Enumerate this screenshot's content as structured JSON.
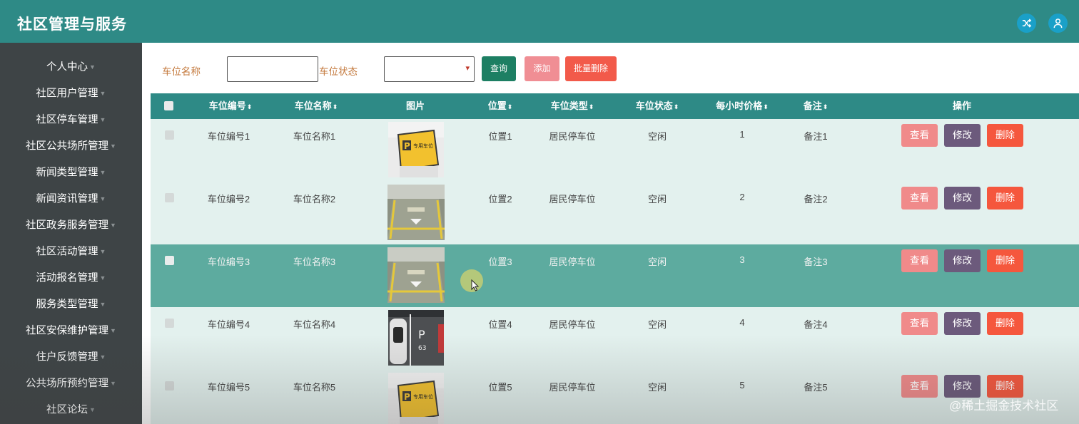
{
  "header": {
    "title": "社区管理与服务",
    "icons": [
      "shuffle-icon",
      "user-icon"
    ]
  },
  "sidebar": {
    "items": [
      {
        "label": "个人中心"
      },
      {
        "label": "社区用户管理"
      },
      {
        "label": "社区停车管理"
      },
      {
        "label": "社区公共场所管理"
      },
      {
        "label": "新闻类型管理"
      },
      {
        "label": "新闻资讯管理"
      },
      {
        "label": "社区政务服务管理"
      },
      {
        "label": "社区活动管理"
      },
      {
        "label": "活动报名管理"
      },
      {
        "label": "服务类型管理"
      },
      {
        "label": "社区安保维护管理"
      },
      {
        "label": "住户反馈管理"
      },
      {
        "label": "公共场所预约管理"
      },
      {
        "label": "社区论坛"
      }
    ]
  },
  "filter": {
    "name_label": "车位名称",
    "name_value": "",
    "status_label": "车位状态",
    "status_value": "",
    "query_label": "查询",
    "add_label": "添加",
    "batch_delete_label": "批量删除"
  },
  "table": {
    "columns": [
      "车位编号",
      "车位名称",
      "图片",
      "位置",
      "车位类型",
      "车位状态",
      "每小时价格",
      "备注",
      "操作"
    ],
    "rows": [
      {
        "code": "车位编号1",
        "name": "车位名称1",
        "image": "reserved-parking-sign",
        "location": "位置1",
        "type": "居民停车位",
        "status": "空闲",
        "price": "1",
        "note": "备注1"
      },
      {
        "code": "车位编号2",
        "name": "车位名称2",
        "image": "parking-lot-floor",
        "location": "位置2",
        "type": "居民停车位",
        "status": "空闲",
        "price": "2",
        "note": "备注2"
      },
      {
        "code": "车位编号3",
        "name": "车位名称3",
        "image": "parking-lot-floor",
        "location": "位置3",
        "type": "居民停车位",
        "status": "空闲",
        "price": "3",
        "note": "备注3"
      },
      {
        "code": "车位编号4",
        "name": "车位名称4",
        "image": "parking-spot-p63",
        "location": "位置4",
        "type": "居民停车位",
        "status": "空闲",
        "price": "4",
        "note": "备注4"
      },
      {
        "code": "车位编号5",
        "name": "车位名称5",
        "image": "reserved-parking-sign",
        "location": "位置5",
        "type": "居民停车位",
        "status": "空闲",
        "price": "5",
        "note": "备注5"
      }
    ],
    "actions": {
      "view": "查看",
      "edit": "修改",
      "delete": "删除"
    },
    "sign_text": "专用车位",
    "spot_text_p": "P",
    "spot_text_num": "63"
  },
  "watermark": "@稀土掘金技术社区",
  "colors": {
    "header_bg": "#2e8a86",
    "sidebar_bg": "#3e4446",
    "query_btn": "#1d7f63",
    "add_btn": "#f08e94",
    "batch_delete_btn": "#f25a4a",
    "view_btn": "#f08a8a",
    "edit_btn": "#6c5a7c",
    "delete_btn": "#f5573d",
    "row_highlight": "#5dab9f",
    "row_bg": "#e3f1ee",
    "filter_label": "#c47a3e"
  }
}
